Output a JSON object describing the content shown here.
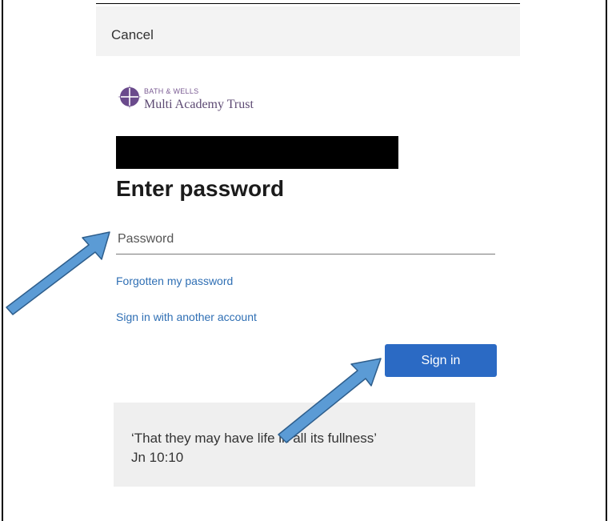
{
  "header": {
    "cancel_label": "Cancel"
  },
  "logo": {
    "line1": "BATH & WELLS",
    "line2": "Multi Academy Trust",
    "icon": "cross-emblem-icon",
    "color": "#6a4a8c"
  },
  "main": {
    "heading": "Enter password",
    "password_placeholder": "Password",
    "forgot_link": "Forgotten my password",
    "another_account_link": "Sign in with another account",
    "signin_label": "Sign in"
  },
  "footer": {
    "quote_line1": "‘That they may have life in all its fullness’",
    "quote_line2": "Jn 10:10"
  },
  "colors": {
    "accent": "#2b6ac4",
    "link": "#2f6fb4",
    "arrow_fill": "#5b9bd5",
    "arrow_stroke": "#2e5e8c"
  },
  "annotations": [
    "arrow-to-password",
    "arrow-to-sign-in"
  ]
}
